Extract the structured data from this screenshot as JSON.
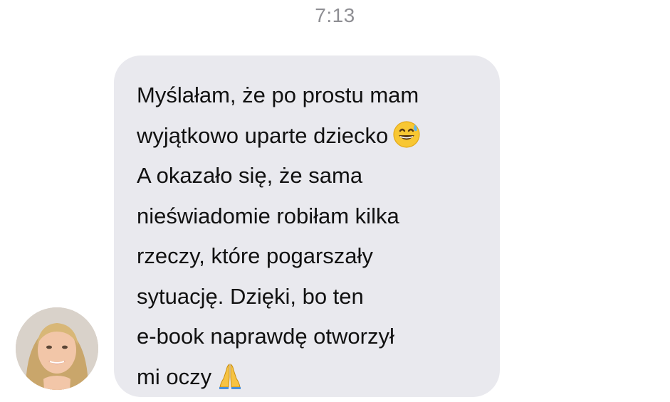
{
  "header": {
    "time": "7:13"
  },
  "message": {
    "sender_avatar": "woman-portrait-avatar",
    "lines": [
      "Myślałam, że po prostu mam",
      "wyjątkowo uparte dziecko",
      "A okazało się, że sama",
      "nieświadomie robiłam kilka",
      "rzeczy, które pogarszały",
      "sytuację. Dzięki, bo ten",
      "e-book naprawdę otworzył",
      "mi oczy"
    ],
    "emojis": {
      "line_2": "grinning-sweat-emoji",
      "line_8": "folded-hands-emoji"
    }
  },
  "colors": {
    "bubble_background": "#e9e9ee",
    "timestamp_text": "#8e8e93",
    "message_text": "#111111"
  }
}
